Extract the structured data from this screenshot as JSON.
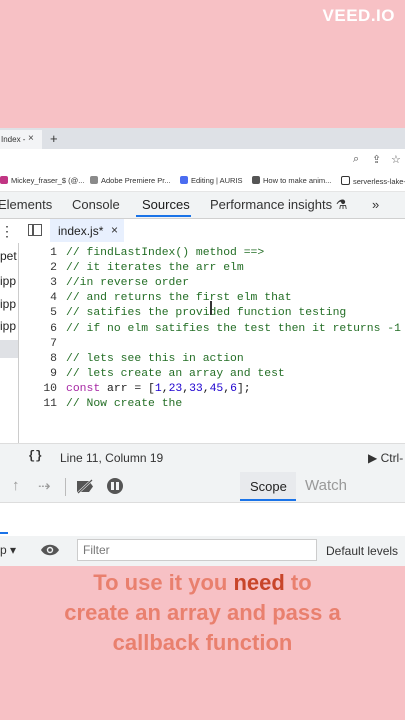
{
  "watermark": "VEED.IO",
  "browser_tab": {
    "title": "Index -",
    "close": "×",
    "new_tab": "+"
  },
  "bookmarks": [
    {
      "label": "Mickey_fraser_$ (@...",
      "color": "#c13584"
    },
    {
      "label": "Adobe Premiere Pr...",
      "color": "#8a8a8a"
    },
    {
      "label": "Editing | AURIS",
      "color": "#4b6cf0"
    },
    {
      "label": "How to make anim...",
      "color": "#555555"
    },
    {
      "label": "serverless-lake-v",
      "color": "#333333"
    }
  ],
  "devtools_tabs": [
    "Elements",
    "Console",
    "Sources",
    "Performance insights",
    "»"
  ],
  "file_tab": {
    "name": "index.js*",
    "close": "×"
  },
  "navigator_items": [
    "pet",
    "ipp",
    "ipp",
    "ipp"
  ],
  "code_lines": [
    {
      "n": "1",
      "text": "// findLastIndex() method ==>"
    },
    {
      "n": "2",
      "text": "// it iterates the arr elm"
    },
    {
      "n": "3",
      "text": "//in reverse order"
    },
    {
      "n": "4",
      "text": "// and returns the first elm that"
    },
    {
      "n": "5",
      "text": "// satifies the provided function testing"
    },
    {
      "n": "6",
      "text": "// if no elm satifies the test then it returns -1"
    },
    {
      "n": "7",
      "text": ""
    },
    {
      "n": "8",
      "text": "// lets see this in action"
    },
    {
      "n": "9",
      "text": "// lets create an array and test"
    },
    {
      "n": "10",
      "text": "const arr = [1,23,33,45,6];"
    },
    {
      "n": "11",
      "text": "// Now create the"
    }
  ],
  "status": {
    "braces": "{}",
    "position": "Line 11, Column 19",
    "coverage": "▶ Ctrl-"
  },
  "debugger": {
    "scope": "Scope",
    "watch": "Watch"
  },
  "console": {
    "context": "p ▾",
    "filter_placeholder": "Filter",
    "levels": "Default levels"
  },
  "caption": {
    "before": "To use it you ",
    "highlight": "need",
    "after": " to create an array and pass a callback function"
  },
  "colors": {
    "background": "#f7c1c5",
    "caption": "#e9806e",
    "caption_highlight": "#c8452a",
    "accent": "#1a73e8"
  }
}
